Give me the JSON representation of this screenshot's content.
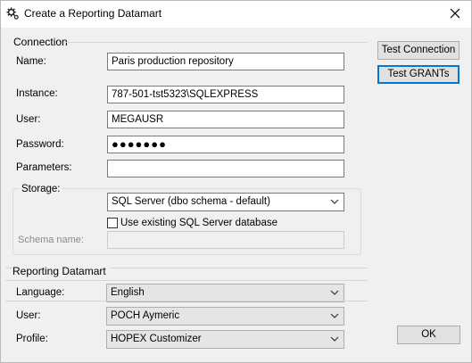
{
  "window": {
    "title": "Create a Reporting Datamart",
    "close_icon": "close-icon",
    "app_icon": "gear-icon"
  },
  "connection": {
    "group_label": "Connection",
    "name_label": "Name:",
    "name_value": "Paris production repository",
    "instance_label": "Instance:",
    "instance_value": "787-501-tst5323\\SQLEXPRESS",
    "user_label": "User:",
    "user_value": "MEGAUSR",
    "password_label": "Password:",
    "password_value": "●●●●●●●",
    "parameters_label": "Parameters:",
    "parameters_value": "",
    "storage_label": "Storage:",
    "storage_value": "SQL Server (dbo schema - default)",
    "use_existing_label": "Use existing SQL Server database",
    "use_existing_checked": false,
    "schema_label": "Schema name:",
    "schema_value": ""
  },
  "datamart": {
    "group_label": "Reporting Datamart",
    "language_label": "Language:",
    "language_value": "English",
    "user_label": "User:",
    "user_value": "POCH Aymeric",
    "profile_label": "Profile:",
    "profile_value": "HOPEX Customizer"
  },
  "buttons": {
    "test_connection": "Test Connection",
    "test_grants": "Test GRANTs",
    "ok": "OK"
  }
}
